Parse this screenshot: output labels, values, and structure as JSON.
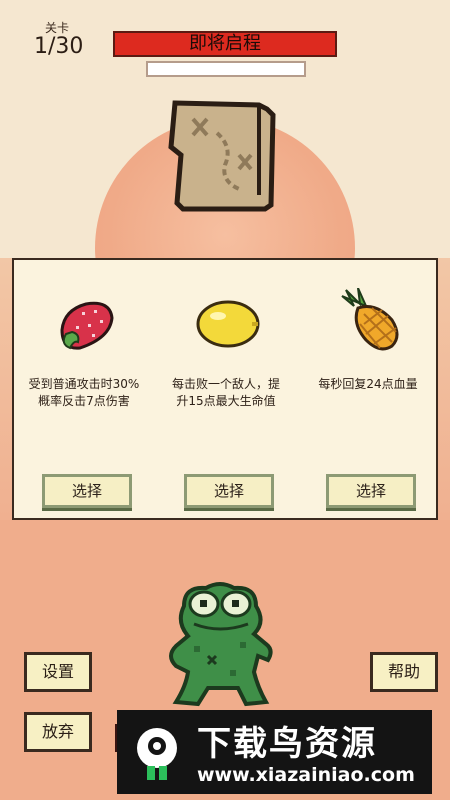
{
  "level": {
    "label": "关卡",
    "value": "1/30"
  },
  "title_banner": "即将启程",
  "progress_fraction": 0,
  "cards": [
    {
      "icon": "strawberry-icon",
      "description": "受到普通攻击时30%概率反击7点伤害",
      "button": "选择"
    },
    {
      "icon": "lemon-icon",
      "description": "每击败一个敌人，提升15点最大生命值",
      "button": "选择"
    },
    {
      "icon": "pineapple-icon",
      "description": "每秒回复24点血量",
      "button": "选择"
    }
  ],
  "buttons": {
    "settings": "设置",
    "give_up": "放弃",
    "help": "帮助"
  },
  "watermark": {
    "title": "下载鸟资源",
    "url": "www.xiazainiao.com"
  },
  "colors": {
    "banner": "#dd2a1f",
    "panel": "#fbf3de",
    "button_bg": "#f7f0c4",
    "bottom_bg": "#f0ad8c"
  }
}
